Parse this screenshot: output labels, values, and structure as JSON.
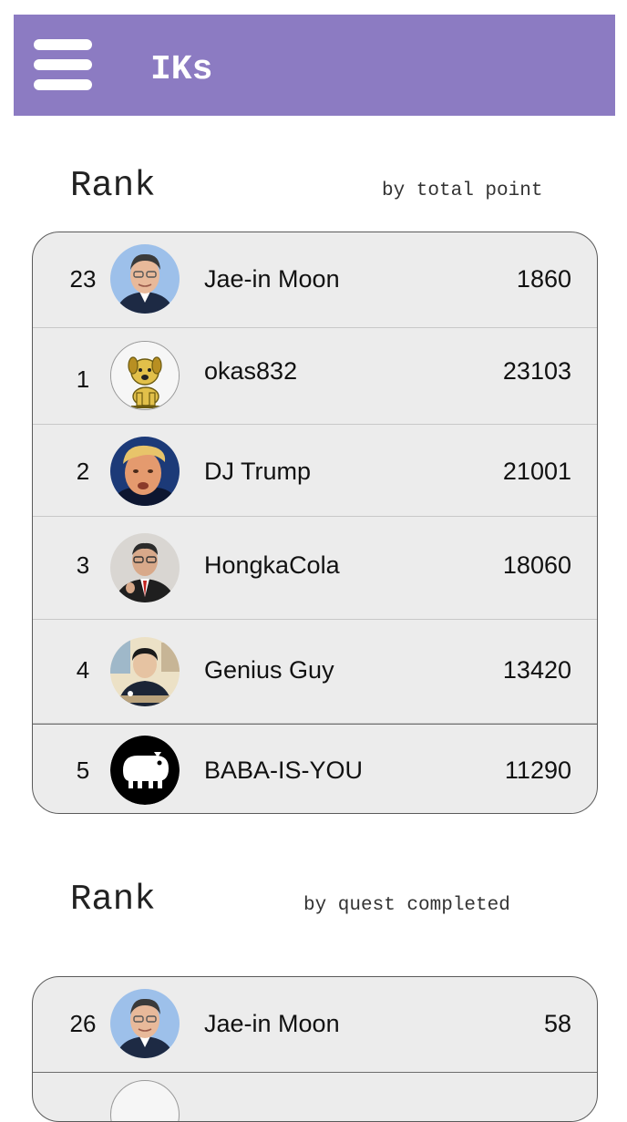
{
  "app": {
    "title": "IKs",
    "accent": "#8c7bc2"
  },
  "rank_total": {
    "title": "Rank",
    "subtitle": "by total point",
    "me": {
      "rank": "23",
      "name": "Jae-in Moon",
      "score": "1860",
      "avatar": "person-portrait-moon"
    },
    "items": [
      {
        "rank": "1",
        "name": "okas832",
        "score": "23103",
        "avatar": "dog-cartoon-avatar"
      },
      {
        "rank": "2",
        "name": "DJ Trump",
        "score": "21001",
        "avatar": "person-portrait-trump"
      },
      {
        "rank": "3",
        "name": "HongkaCola",
        "score": "18060",
        "avatar": "person-portrait-hong"
      },
      {
        "rank": "4",
        "name": "Genius Guy",
        "score": "13420",
        "avatar": "person-portrait-genius"
      },
      {
        "rank": "5",
        "name": "BABA-IS-YOU",
        "score": "11290",
        "avatar": "baba-creature-avatar"
      }
    ]
  },
  "rank_quest": {
    "title": "Rank",
    "subtitle": "by quest completed",
    "me": {
      "rank": "26",
      "name": "Jae-in Moon",
      "score": "58",
      "avatar": "person-portrait-moon"
    }
  }
}
